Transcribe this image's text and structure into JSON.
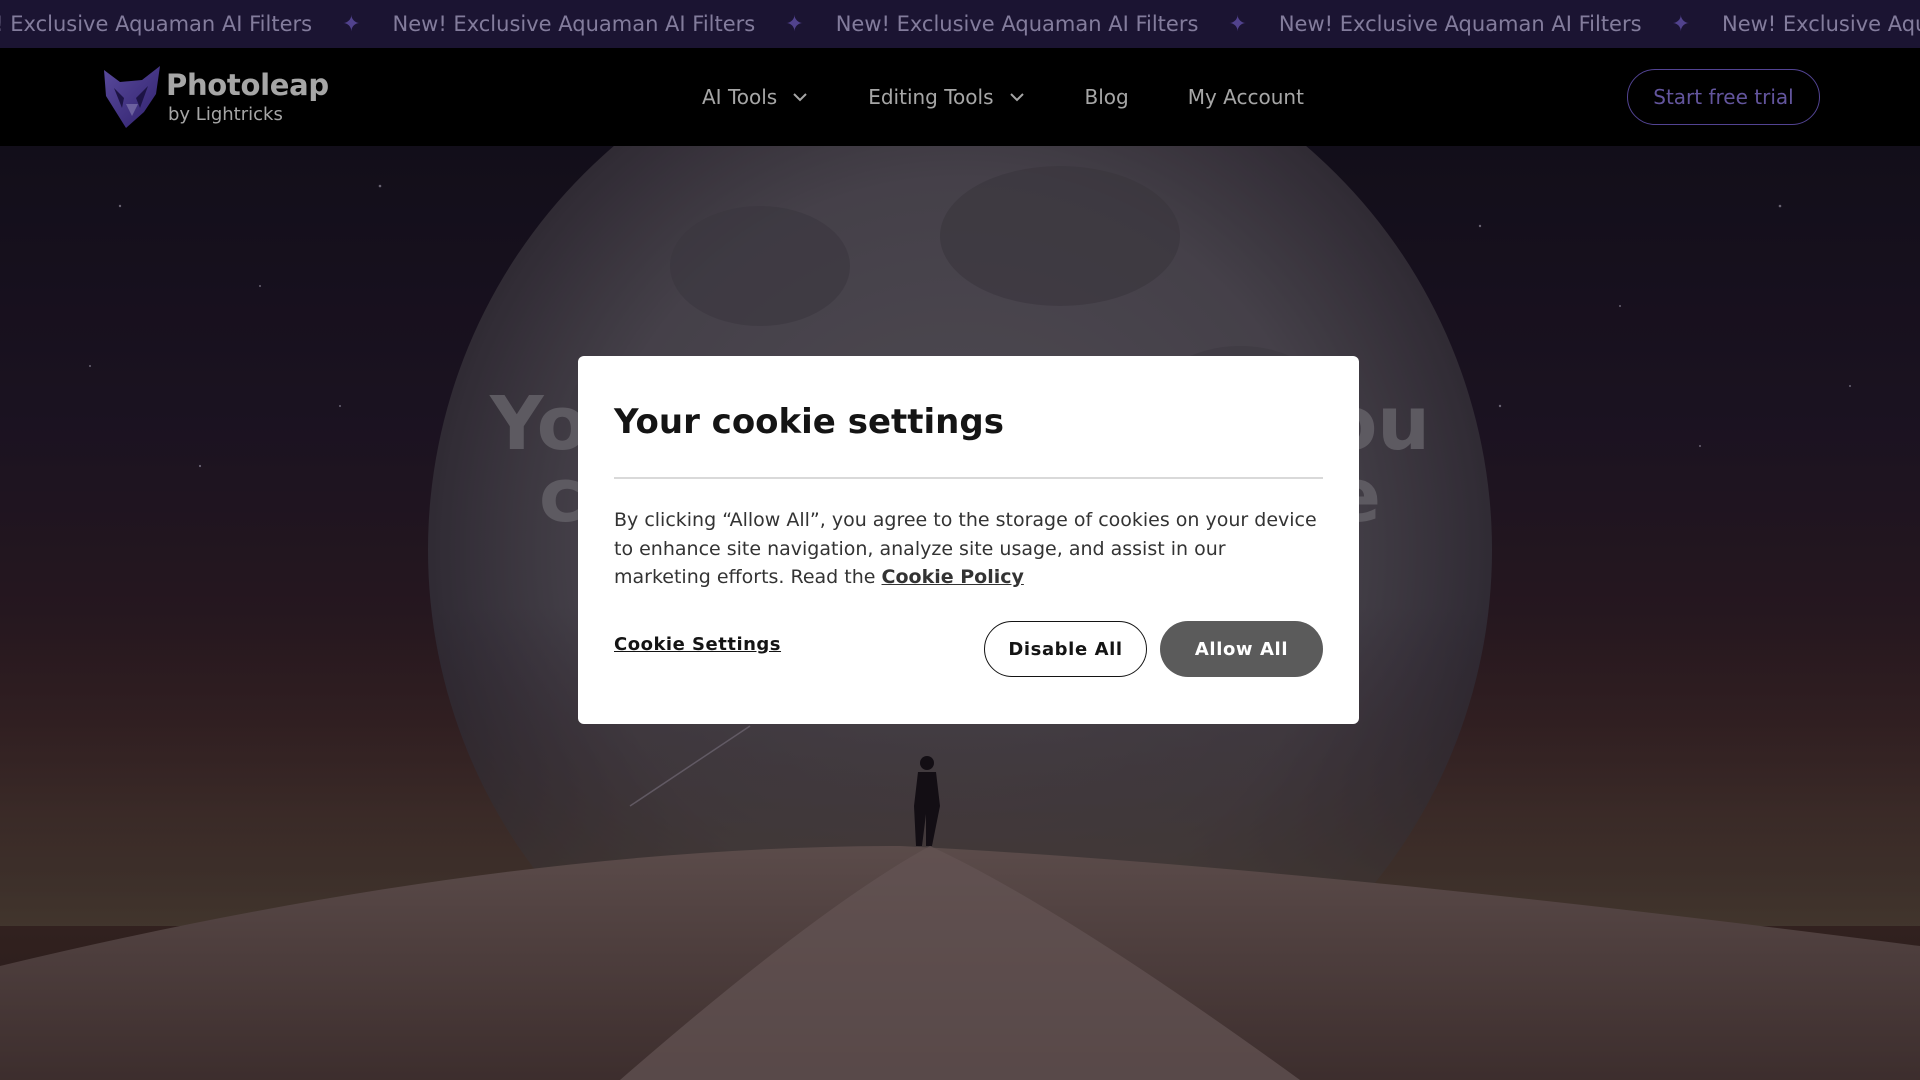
{
  "ticker": {
    "message": "New! Exclusive Aquaman AI Filters",
    "leading_fragment": "w! Exclusive Aquaman AI Filters",
    "separator_icon": "sparkle-icon"
  },
  "header": {
    "logo_name": "Photoleap",
    "logo_sub": "by Lightricks",
    "nav": [
      {
        "label": "AI Tools",
        "has_dropdown": true
      },
      {
        "label": "Editing Tools",
        "has_dropdown": true
      },
      {
        "label": "Blog",
        "has_dropdown": false
      },
      {
        "label": "My Account",
        "has_dropdown": false
      }
    ],
    "cta_label": "Start free trial"
  },
  "hero": {
    "title_line1_left": "You",
    "title_line1_right": "ou",
    "title_line2_left": "c",
    "title_line2_right": "e"
  },
  "cookie_modal": {
    "title": "Your cookie settings",
    "body_text": "By clicking “Allow All”, you agree to the storage of cookies on your device to enhance site navigation, analyze site usage, and assist in our marketing efforts. Read the",
    "policy_link": "Cookie Policy",
    "settings_link": "Cookie Settings",
    "disable_label": "Disable All",
    "allow_label": "Allow All"
  },
  "colors": {
    "ticker_bg": "#2a1f4e",
    "accent": "#7e68e0",
    "modal_allow_bg": "#5b5b5b"
  }
}
